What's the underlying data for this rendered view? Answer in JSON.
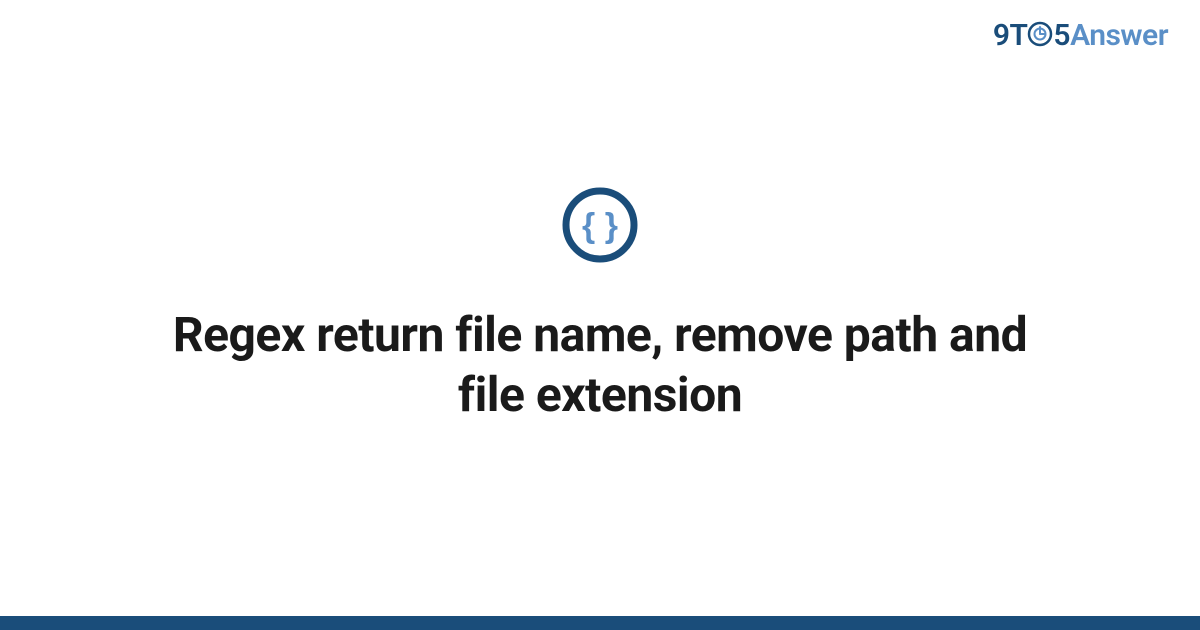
{
  "brand": {
    "part1": "9T",
    "part2": "5",
    "part3": "Answer"
  },
  "title": "Regex return file name, remove path and file extension",
  "colors": {
    "brand_dark": "#1a4d7a",
    "brand_light": "#5a8fc7",
    "icon_inner": "#5a8fc7",
    "text": "#1a1a1a"
  },
  "icon": {
    "name": "curly-braces"
  }
}
